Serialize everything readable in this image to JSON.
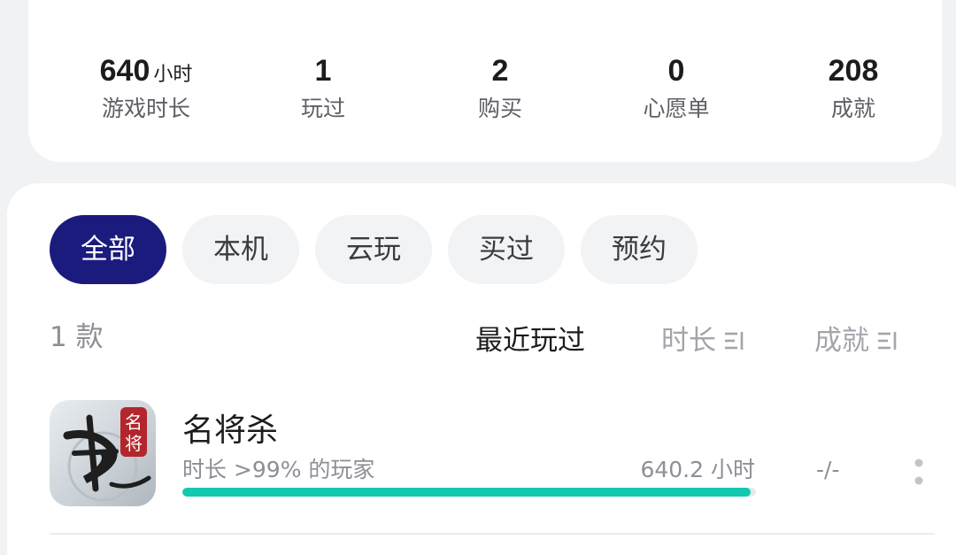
{
  "stats": [
    {
      "value": "640",
      "unit": "小时",
      "label": "游戏时长"
    },
    {
      "value": "1",
      "unit": "",
      "label": "玩过"
    },
    {
      "value": "2",
      "unit": "",
      "label": "购买"
    },
    {
      "value": "0",
      "unit": "",
      "label": "心愿单"
    },
    {
      "value": "208",
      "unit": "",
      "label": "成就"
    }
  ],
  "filters": [
    {
      "label": "全部",
      "active": true
    },
    {
      "label": "本机",
      "active": false
    },
    {
      "label": "云玩",
      "active": false
    },
    {
      "label": "买过",
      "active": false
    },
    {
      "label": "预约",
      "active": false
    }
  ],
  "list": {
    "count_label": "1 款",
    "sort_options": [
      {
        "label": "最近玩过",
        "active": true
      },
      {
        "label": "时长",
        "active": false,
        "icon": "sort-icon"
      },
      {
        "label": "成就",
        "active": false,
        "icon": "sort-icon"
      }
    ]
  },
  "games": [
    {
      "icon": "game-cover-icon",
      "icon_text": [
        "名",
        "将"
      ],
      "title": "名将杀",
      "desc": "时长 >99% 的玩家",
      "hours": "640.2 小时",
      "progress": 0.99,
      "achievements": "-/-"
    }
  ],
  "colors": {
    "accent": "#1b1b7e",
    "progress": "#12c9b0",
    "background": "#f1f2f4"
  }
}
